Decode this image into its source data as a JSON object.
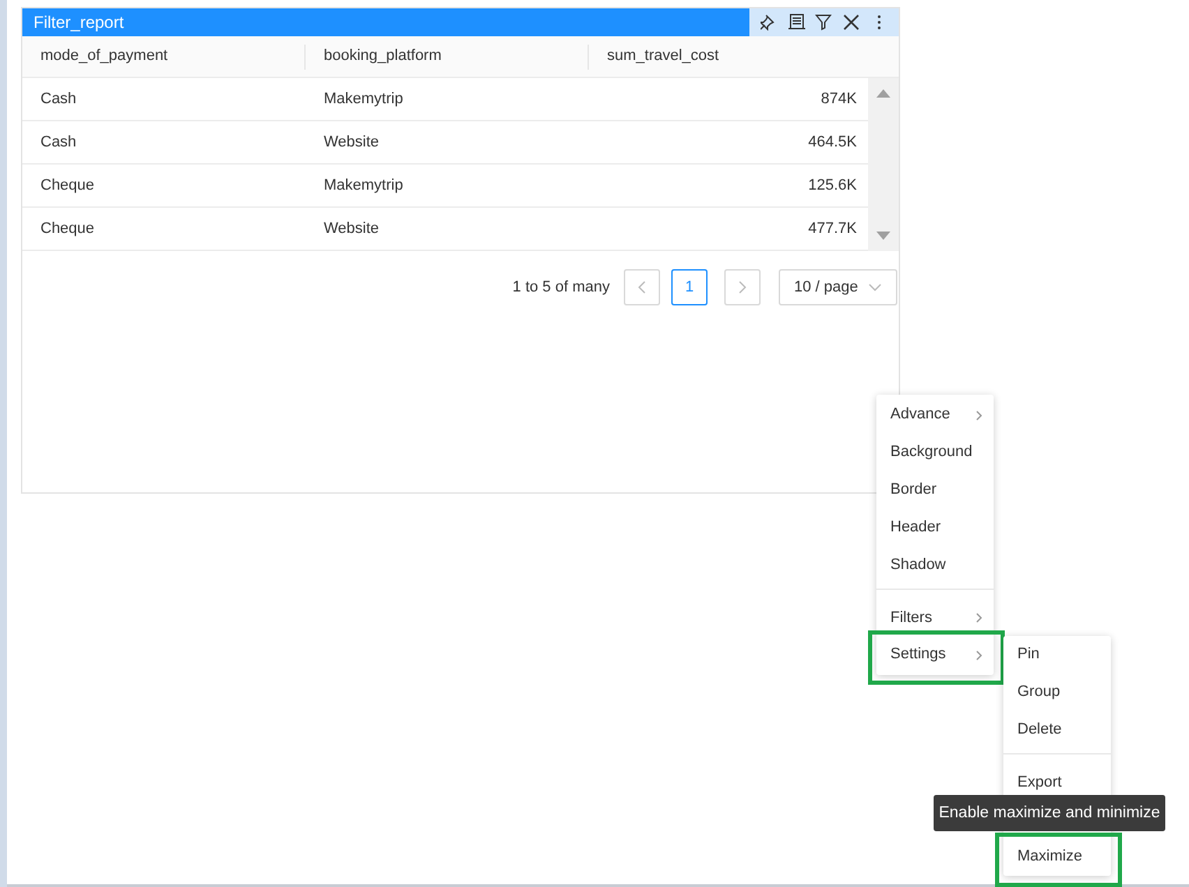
{
  "widget": {
    "title": "Filter_report"
  },
  "table": {
    "columns": [
      "mode_of_payment",
      "booking_platform",
      "sum_travel_cost"
    ],
    "rows": [
      [
        "Cash",
        "Makemytrip",
        "874K"
      ],
      [
        "Cash",
        "Website",
        "464.5K"
      ],
      [
        "Cheque",
        "Makemytrip",
        "125.6K"
      ],
      [
        "Cheque",
        "Website",
        "477.7K"
      ]
    ]
  },
  "pagination": {
    "summary": "1 to 5 of many",
    "pages": [
      {
        "label": "1",
        "selected": true
      }
    ],
    "page_size": "10 / page"
  },
  "context_menu": {
    "items": [
      {
        "label": "Advance",
        "submenu": true,
        "highlighted": false,
        "divider_before": false
      },
      {
        "label": "Background",
        "submenu": false,
        "highlighted": false,
        "divider_before": false
      },
      {
        "label": "Border",
        "submenu": false,
        "highlighted": false,
        "divider_before": false
      },
      {
        "label": "Header",
        "submenu": false,
        "highlighted": false,
        "divider_before": false
      },
      {
        "label": "Shadow",
        "submenu": false,
        "highlighted": false,
        "divider_before": false
      },
      {
        "label": "Filters",
        "submenu": true,
        "highlighted": false,
        "divider_before": true
      },
      {
        "label": "Settings",
        "submenu": true,
        "highlighted": true,
        "divider_before": false
      }
    ]
  },
  "submenu": {
    "items": [
      {
        "label": "Pin",
        "highlighted": false,
        "divider_before": false
      },
      {
        "label": "Group",
        "highlighted": false,
        "divider_before": false
      },
      {
        "label": "Delete",
        "highlighted": false,
        "divider_before": false
      },
      {
        "label": "Export",
        "highlighted": false,
        "divider_before": true
      },
      {
        "label": "Maximize",
        "highlighted": true,
        "divider_before": false
      }
    ]
  },
  "tooltip": "Enable maximize and minimize"
}
